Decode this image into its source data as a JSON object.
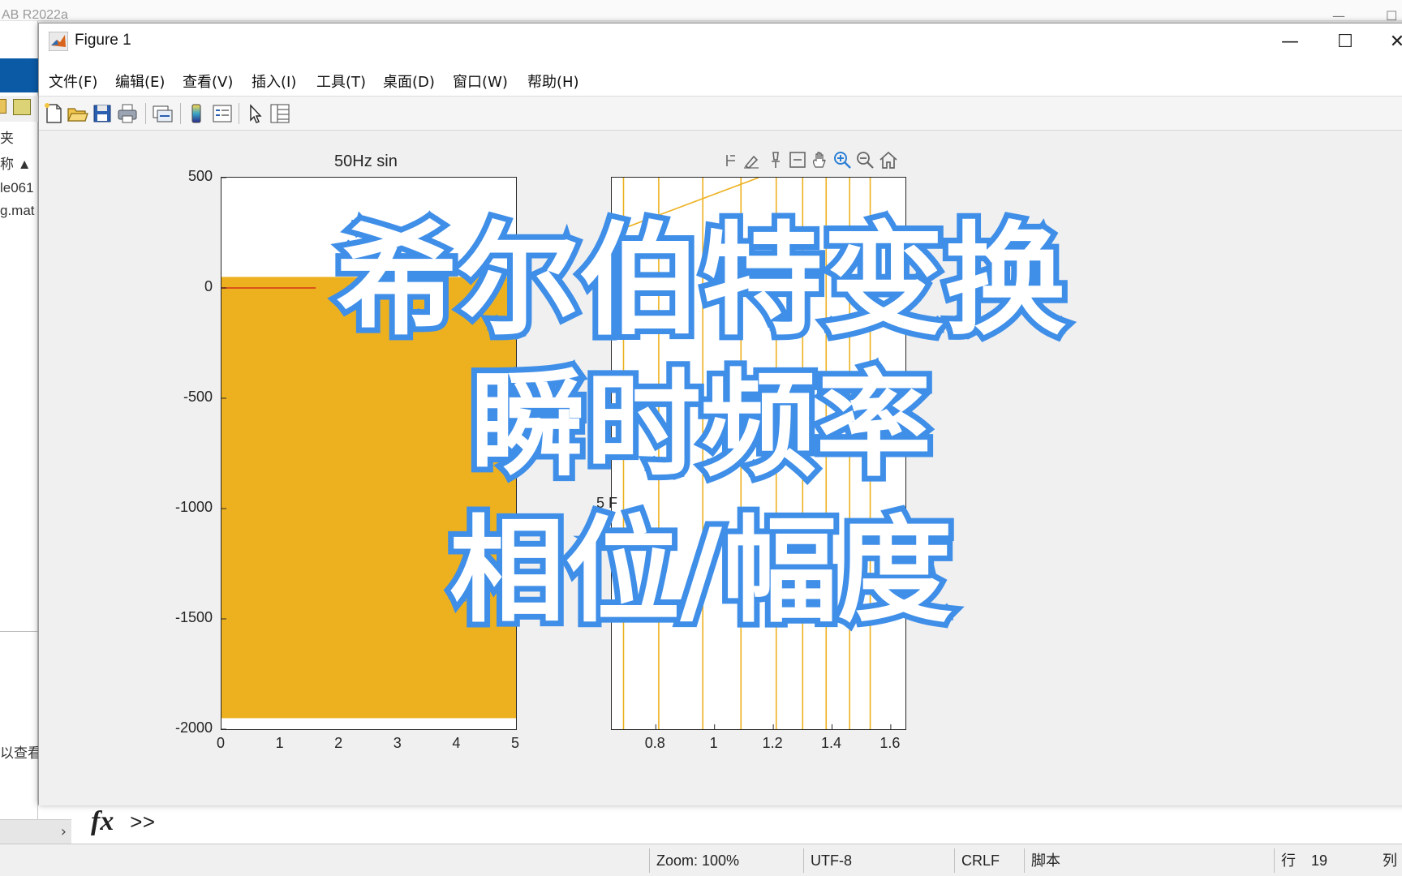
{
  "background": {
    "app_title": "AB R2022a",
    "left_panel": {
      "label_a": "夹",
      "label_name": "称",
      "files": [
        "le061",
        "g.mat"
      ],
      "bottom_text": "以查看"
    },
    "command": {
      "fx": "fx",
      "prompt": ">>"
    }
  },
  "status": {
    "zoom": "Zoom: 100%",
    "encoding": "UTF-8",
    "eol": "CRLF",
    "type": "脚本",
    "row_label": "行",
    "row": "19",
    "col_label": "列"
  },
  "figure": {
    "title": "Figure 1",
    "menu": [
      "文件(F)",
      "编辑(E)",
      "查看(V)",
      "插入(I)",
      "工具(T)",
      "桌面(D)",
      "窗口(W)",
      "帮助(H)"
    ],
    "toolbar": [
      "new-figure-icon",
      "open-icon",
      "save-icon",
      "print-icon",
      "link-icon",
      "colorbar-icon",
      "legend-icon",
      "pointer-icon",
      "property-inspector-icon"
    ],
    "axes_toolbar": [
      "data-tips-icon",
      "brush-icon",
      "pin-icon",
      "restore-view-icon",
      "pan-icon",
      "zoom-in-icon",
      "zoom-out-icon",
      "home-icon"
    ]
  },
  "chart_data": [
    {
      "type": "area",
      "title": "50Hz sin",
      "xlim": [
        0,
        5
      ],
      "ylim": [
        -2000,
        500
      ],
      "xticks": [
        "0",
        "1",
        "2",
        "3",
        "4",
        "5"
      ],
      "yticks": [
        "500",
        "0",
        "-500",
        "-1000",
        "-1500",
        "-2000"
      ],
      "fill_color": "#edb120",
      "line_color": "#d95319",
      "fill_range": [
        -1950,
        50
      ],
      "line_y": 0
    },
    {
      "type": "line",
      "xlim": [
        0.65,
        1.65
      ],
      "xticks": [
        "0.8",
        "1",
        "1.2",
        "1.4",
        "1.6"
      ],
      "line_color": "#edb120",
      "verticals": [
        0.69,
        0.81,
        0.96,
        1.09,
        1.21,
        1.3,
        1.38,
        1.46,
        1.53
      ],
      "diagonal": {
        "x": [
          0.65,
          1.15
        ]
      },
      "partial_label": "5 F"
    }
  ],
  "overlay": {
    "line1": "希尔伯特变换",
    "line2": "瞬时频率",
    "line3": "相位/幅度",
    "stroke_color": "#3f8ee8"
  }
}
